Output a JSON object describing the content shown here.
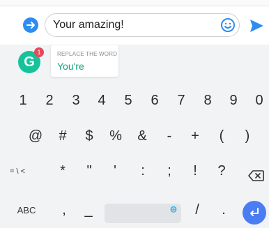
{
  "compose": {
    "text": "Your amazing!"
  },
  "grammarly": {
    "badge": "1",
    "label": "REPLACE THE WORD",
    "suggestion": "You're"
  },
  "keyboard": {
    "row1": [
      "1",
      "2",
      "3",
      "4",
      "5",
      "6",
      "7",
      "8",
      "9",
      "0"
    ],
    "row2": [
      "@",
      "#",
      "$",
      "%",
      "&",
      "-",
      "+",
      "(",
      ")"
    ],
    "row3": [
      "= \\ <",
      "*",
      "\"",
      "'",
      ":",
      ";",
      "!",
      "?"
    ],
    "row4": [
      "ABC",
      ",",
      "_",
      "/",
      "."
    ]
  },
  "icons": {
    "left_action": "arrow-right-icon",
    "emoji": "emoji-icon",
    "send": "send-icon",
    "delete": "backspace-icon",
    "globe": "globe-icon",
    "enter": "enter-icon"
  }
}
